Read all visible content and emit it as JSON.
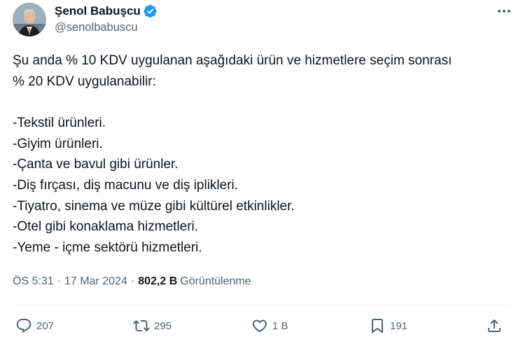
{
  "user": {
    "display_name": "Şenol Babuşcu",
    "handle": "@senolbabuscu",
    "verified_icon": "verified-badge-icon",
    "verified_color": "#1d9bf0"
  },
  "tweet": {
    "intro_line1": "Şu anda % 10 KDV uygulanan aşağıdaki ürün ve hizmetlere seçim sonrası",
    "intro_line2": "% 20 KDV uygulanabilir:",
    "items": [
      "-Tekstil ürünleri.",
      "-Giyim ürünleri.",
      "-Çanta ve bavul gibi ürünler.",
      "-Diş fırçası, diş macunu ve diş iplikleri.",
      "-Tiyatro, sinema ve müze gibi kültürel etkinlikler.",
      "-Otel gibi konaklama hizmetleri.",
      "-Yeme - içme sektörü hizmetleri."
    ]
  },
  "meta": {
    "time": "ÖS 5:31",
    "separator": "·",
    "date": "17 Mar 2024",
    "views_count": "802,2 B",
    "views_label": "Görüntülenme"
  },
  "actions": {
    "replies": "207",
    "retweets": "295",
    "likes": "1 B",
    "bookmarks": "191"
  },
  "colors": {
    "text": "#0f1419",
    "secondary": "#536471",
    "divider": "#eff3f4"
  }
}
